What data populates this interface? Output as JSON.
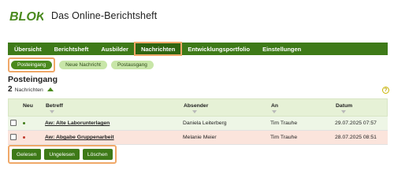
{
  "header": {
    "logo_text": "Blok",
    "title": "Das Online-Berichtsheft"
  },
  "nav": {
    "items": [
      {
        "label": "Übersicht"
      },
      {
        "label": "Berichtsheft"
      },
      {
        "label": "Ausbilder"
      },
      {
        "label": "Nachrichten"
      },
      {
        "label": "Entwicklungsportfolio"
      },
      {
        "label": "Einstellungen"
      }
    ],
    "active": "Nachrichten"
  },
  "subtabs": {
    "items": [
      {
        "label": "Posteingang"
      },
      {
        "label": "Neue Nachricht"
      },
      {
        "label": "Postausgang"
      }
    ],
    "active": "Posteingang"
  },
  "inbox": {
    "title": "Posteingang",
    "count": "2",
    "count_label": "Nachrichten",
    "help": "?"
  },
  "table": {
    "headers": {
      "new": "Neu",
      "subject": "Betreff",
      "sender": "Absender",
      "to": "An",
      "date": "Datum"
    },
    "rows": [
      {
        "subject": "Aw: Alte Laborunterlagen",
        "sender": "Daniela Leiterberg",
        "to": "Tim Trauhe",
        "date": "29.07.2025 07:57",
        "dot_color": "#3e7a18"
      },
      {
        "subject": "Aw: Abgabe Gruppenarbeit",
        "sender": "Melanie Meier",
        "to": "Tim Trauhe",
        "date": "28.07.2025 08:51",
        "dot_color": "#c0392b"
      }
    ]
  },
  "actions": {
    "read": "Gelesen",
    "unread": "Ungelesen",
    "delete": "Löschen"
  },
  "colors": {
    "primary": "#3e7a18",
    "highlight": "#f0a868",
    "row_unread_bg": "#fbe4dc"
  }
}
